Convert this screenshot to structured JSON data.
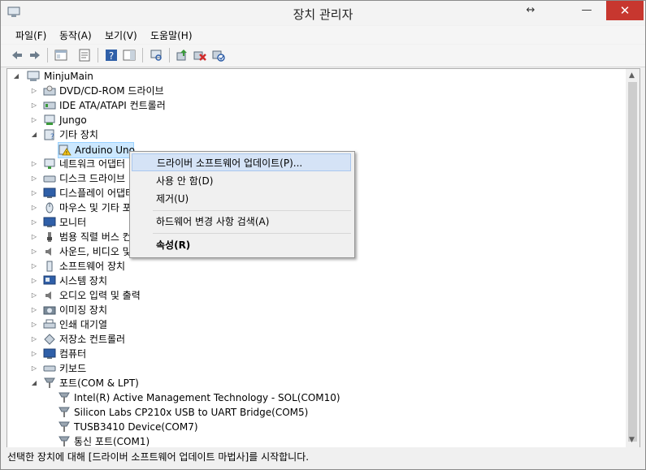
{
  "window": {
    "title": "장치 관리자"
  },
  "menu": [
    "파일(F)",
    "동작(A)",
    "보기(V)",
    "도움말(H)"
  ],
  "toolbar": [
    "back-icon",
    "forward-icon",
    "show-hide-tree-icon",
    "properties-icon",
    "help-icon",
    "action-pane-icon",
    "scan-hardware-icon",
    "update-driver-icon",
    "uninstall-icon",
    "enable-device-icon"
  ],
  "tree": {
    "root": "MinjuMain",
    "items": [
      {
        "label": "DVD/CD-ROM 드라이브",
        "expanded": false
      },
      {
        "label": "IDE ATA/ATAPI 컨트롤러",
        "expanded": false
      },
      {
        "label": "Jungo",
        "expanded": false
      },
      {
        "label": "기타 장치",
        "expanded": true
      },
      {
        "label": "Arduino Uno",
        "child": true,
        "selected": true,
        "warning": true
      },
      {
        "label": "네트워크 어댑터",
        "expanded": false
      },
      {
        "label": "디스크 드라이브",
        "expanded": false
      },
      {
        "label": "디스플레이 어댑터",
        "expanded": false
      },
      {
        "label": "마우스 및 기타 포인팅 장치",
        "expanded": false
      },
      {
        "label": "모니터",
        "expanded": false
      },
      {
        "label": "범용 직렬 버스 컨트롤러",
        "expanded": false
      },
      {
        "label": "사운드, 비디오 및 게임 컨트롤러",
        "expanded": false
      },
      {
        "label": "소프트웨어 장치",
        "expanded": false
      },
      {
        "label": "시스템 장치",
        "expanded": false
      },
      {
        "label": "오디오 입력 및 출력",
        "expanded": false
      },
      {
        "label": "이미징 장치",
        "expanded": false
      },
      {
        "label": "인쇄 대기열",
        "expanded": false
      },
      {
        "label": "저장소 컨트롤러",
        "expanded": false
      },
      {
        "label": "컴퓨터",
        "expanded": false
      },
      {
        "label": "키보드",
        "expanded": false
      },
      {
        "label": "포트(COM & LPT)",
        "expanded": true
      },
      {
        "label": "Intel(R) Active Management Technology - SOL(COM10)",
        "child": true
      },
      {
        "label": "Silicon Labs CP210x USB to UART Bridge(COM5)",
        "child": true
      },
      {
        "label": "TUSB3410 Device(COM7)",
        "child": true
      },
      {
        "label": "통신 포트(COM1)",
        "child": true
      }
    ]
  },
  "context_menu": {
    "update_driver": "드라이버 소프트웨어 업데이트(P)...",
    "disable": "사용 안 함(D)",
    "uninstall": "제거(U)",
    "scan": "하드웨어 변경 사항 검색(A)",
    "properties": "속성(R)"
  },
  "status": "선택한 장치에 대해 [드라이버 소프트웨어 업데이트 마법사]를 시작합니다."
}
